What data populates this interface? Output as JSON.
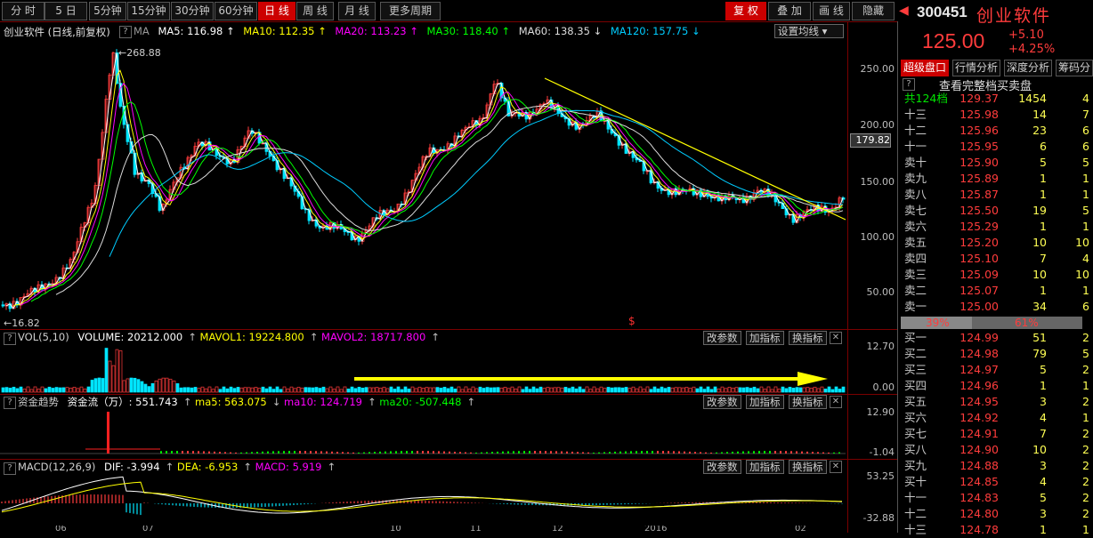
{
  "toolbar": {
    "periods": [
      "分 时",
      "5 日",
      "5分钟",
      "15分钟",
      "30分钟",
      "60分钟",
      "日 线",
      "周 线",
      "月 线",
      "更多周期"
    ],
    "active": "日 线",
    "right_buttons": [
      "复 权",
      "叠 加",
      "画 线",
      "隐藏"
    ],
    "right_active": "复 权"
  },
  "main_chart": {
    "stock_label": "创业软件 (日线,前复权)",
    "ma_label": "MA",
    "ma": [
      {
        "label": "MA5: 116.98",
        "color": "#ffffff"
      },
      {
        "label": "MA10: 112.35",
        "color": "#ffff00"
      },
      {
        "label": "MA20: 113.23",
        "color": "#ff00ff"
      },
      {
        "label": "MA30: 118.40",
        "color": "#00ff00"
      },
      {
        "label": "MA60: 138.35",
        "color": "#dcdcdc"
      },
      {
        "label": "MA120: 157.75",
        "color": "#00ccff"
      }
    ],
    "settings_button": "设置均线",
    "high_marker": "268.88",
    "low_marker": "16.82",
    "current_tag": "179.82",
    "y_ticks": [
      "250.00",
      "200.00",
      "150.00",
      "100.00",
      "50.00"
    ]
  },
  "volume_panel": {
    "label": "VOL(5,10)",
    "values": [
      {
        "text": "VOLUME: 20212.000",
        "color": "#ffffff"
      },
      {
        "text": "MAVOL1: 19224.800",
        "color": "#ffff00"
      },
      {
        "text": "MAVOL2: 18717.800",
        "color": "#ff00ff"
      }
    ],
    "buttons": [
      "改参数",
      "加指标",
      "换指标"
    ],
    "y_ticks": [
      "12.70",
      "0.00"
    ]
  },
  "fund_panel": {
    "label": "资金趋势",
    "values": [
      {
        "text": "资金流（万）: 551.743",
        "color": "#ffffff"
      },
      {
        "text": "ma5: 563.075",
        "color": "#ffff00"
      },
      {
        "text": "ma10: 124.719",
        "color": "#ff00ff"
      },
      {
        "text": "ma20: -507.448",
        "color": "#00ff00"
      }
    ],
    "buttons": [
      "改参数",
      "加指标",
      "换指标"
    ],
    "y_ticks": [
      "12.90",
      "-1.04"
    ]
  },
  "macd_panel": {
    "label": "MACD(12,26,9)",
    "values": [
      {
        "text": "DIF: -3.994",
        "color": "#ffffff"
      },
      {
        "text": "DEA: -6.953",
        "color": "#ffff00"
      },
      {
        "text": "MACD: 5.919",
        "color": "#ff00ff"
      }
    ],
    "buttons": [
      "改参数",
      "加指标",
      "换指标"
    ],
    "y_ticks": [
      "53.25",
      "-32.88"
    ]
  },
  "x_labels": [
    "06",
    "07",
    "10",
    "11",
    "12",
    "2016",
    "02"
  ],
  "quote": {
    "code": "300451",
    "name": "创业软件",
    "price": "125.00",
    "change": "+5.10",
    "change_pct": "+4.25%",
    "tabs": [
      "超级盘口",
      "行情分析",
      "深度分析",
      "筹码分"
    ],
    "active_tab": "超级盘口",
    "view_full": "查看完整档买卖盘",
    "total_row": {
      "name": "共124档",
      "price": "129.37",
      "vol": "1454",
      "cnt": "4"
    },
    "asks": [
      {
        "name": "十三",
        "price": "125.98",
        "vol": "14",
        "cnt": "7"
      },
      {
        "name": "十二",
        "price": "125.96",
        "vol": "23",
        "cnt": "6"
      },
      {
        "name": "十一",
        "price": "125.95",
        "vol": "6",
        "cnt": "6"
      },
      {
        "name": "卖十",
        "price": "125.90",
        "vol": "5",
        "cnt": "5"
      },
      {
        "name": "卖九",
        "price": "125.89",
        "vol": "1",
        "cnt": "1"
      },
      {
        "name": "卖八",
        "price": "125.87",
        "vol": "1",
        "cnt": "1"
      },
      {
        "name": "卖七",
        "price": "125.50",
        "vol": "19",
        "cnt": "5"
      },
      {
        "name": "卖六",
        "price": "125.29",
        "vol": "1",
        "cnt": "1"
      },
      {
        "name": "卖五",
        "price": "125.20",
        "vol": "10",
        "cnt": "10"
      },
      {
        "name": "卖四",
        "price": "125.10",
        "vol": "7",
        "cnt": "4"
      },
      {
        "name": "卖三",
        "price": "125.09",
        "vol": "10",
        "cnt": "10"
      },
      {
        "name": "卖二",
        "price": "125.07",
        "vol": "1",
        "cnt": "1"
      },
      {
        "name": "卖一",
        "price": "125.00",
        "vol": "34",
        "cnt": "6"
      }
    ],
    "ratio_left": "39%",
    "ratio_right": "61%",
    "bids": [
      {
        "name": "买一",
        "price": "124.99",
        "vol": "51",
        "cnt": "2"
      },
      {
        "name": "买二",
        "price": "124.98",
        "vol": "79",
        "cnt": "5"
      },
      {
        "name": "买三",
        "price": "124.97",
        "vol": "5",
        "cnt": "2"
      },
      {
        "name": "买四",
        "price": "124.96",
        "vol": "1",
        "cnt": "1"
      },
      {
        "name": "买五",
        "price": "124.95",
        "vol": "3",
        "cnt": "2"
      },
      {
        "name": "买六",
        "price": "124.92",
        "vol": "4",
        "cnt": "1"
      },
      {
        "name": "买七",
        "price": "124.91",
        "vol": "7",
        "cnt": "2"
      },
      {
        "name": "买八",
        "price": "124.90",
        "vol": "10",
        "cnt": "2"
      },
      {
        "name": "买九",
        "price": "124.88",
        "vol": "3",
        "cnt": "2"
      },
      {
        "name": "买十",
        "price": "124.85",
        "vol": "4",
        "cnt": "2"
      },
      {
        "name": "十一",
        "price": "124.83",
        "vol": "5",
        "cnt": "2"
      },
      {
        "name": "十二",
        "price": "124.80",
        "vol": "3",
        "cnt": "2"
      },
      {
        "name": "十三",
        "price": "124.78",
        "vol": "1",
        "cnt": "1"
      }
    ]
  },
  "colors": {
    "up": "#ff3c3c",
    "down": "#00e5ff",
    "accent": "#c00000",
    "grid": "#7a0000"
  }
}
